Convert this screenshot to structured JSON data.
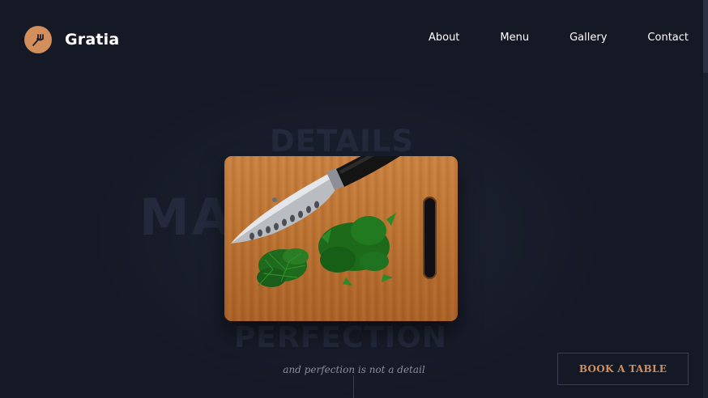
{
  "brand": {
    "name": "Gratia",
    "icon": "fork-knife-icon",
    "accent": "#d28f5c"
  },
  "nav": {
    "items": [
      {
        "label": "About"
      },
      {
        "label": "Menu"
      },
      {
        "label": "Gallery"
      },
      {
        "label": "Contact"
      }
    ]
  },
  "hero": {
    "bg_words": {
      "top": "DETAILS",
      "middle": "MAKE",
      "bottom": "PERFECTION"
    },
    "tagline": "and perfection is not a detail",
    "image": "knife-on-cutting-board"
  },
  "cta": {
    "label": "BOOK A TABLE"
  },
  "colors": {
    "background": "#151926",
    "bg_word": "#242a3c",
    "accent": "#d28f5c"
  }
}
